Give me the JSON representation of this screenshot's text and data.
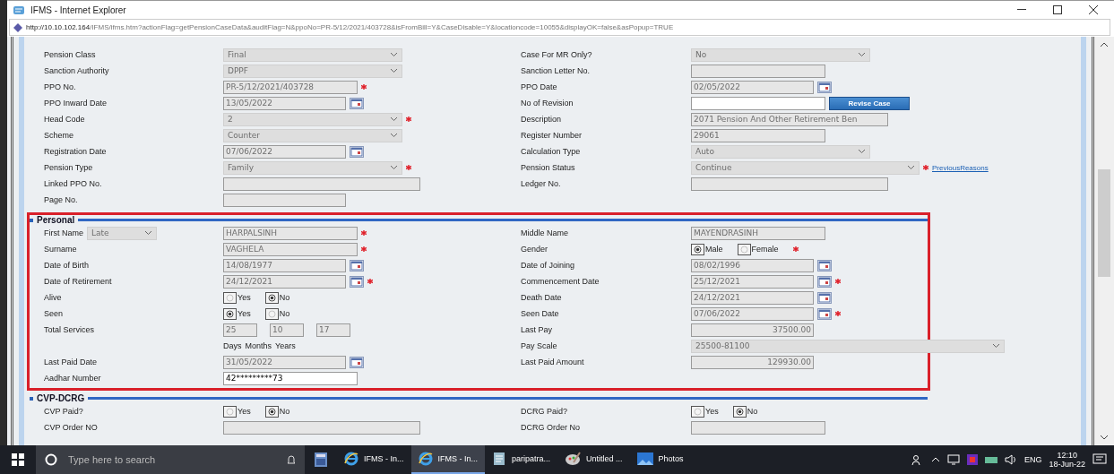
{
  "window": {
    "title": "IFMS - Internet Explorer"
  },
  "address": {
    "host": "http://10.10.102.164",
    "path": "/IFMS/ifms.htm?actionFlag=getPensionCaseData&auditFlag=N&ppoNo=PR-5/12/2021/403728&isFromBill=Y&CaseDisable=Y&locationcode=10055&displayOK=false&asPopup=TRUE"
  },
  "sections": [
    {
      "highlighted": false,
      "rows": [
        {
          "left": {
            "label": "Pension Class",
            "kind": "select",
            "value": "Final",
            "disabled": true
          },
          "right": {
            "label": "Case For MR Only?",
            "kind": "select",
            "value": "No",
            "disabled": true
          }
        },
        {
          "left": {
            "label": "Sanction Authority",
            "kind": "select",
            "value": "DPPF",
            "disabled": true
          },
          "right": {
            "label": "Sanction Letter No.",
            "kind": "text",
            "disabled": true
          }
        },
        {
          "left": {
            "label": "PPO No.",
            "kind": "text",
            "value": "PR-5/12/2021/403728",
            "disabled": true,
            "required": true
          },
          "right": {
            "label": "PPO Date",
            "kind": "date",
            "value": "02/05/2022",
            "disabled": true
          }
        },
        {
          "left": {
            "label": "PPO Inward Date",
            "kind": "date",
            "value": "13/05/2022",
            "disabled": true
          },
          "right": {
            "label": "No of Revision",
            "kind": "text_button",
            "disabled": false,
            "button": "Revise Case"
          }
        },
        {
          "left": {
            "label": "Head Code",
            "kind": "select",
            "value": "2",
            "disabled": true,
            "required": true
          },
          "right": {
            "label": "Description",
            "kind": "wide",
            "value": "2071 Pension And Other Retirement Ben",
            "disabled": true
          }
        },
        {
          "left": {
            "label": "Scheme",
            "kind": "select",
            "value": "Counter",
            "disabled": true
          },
          "right": {
            "label": "Register Number",
            "kind": "text",
            "value": "29061",
            "disabled": true
          }
        },
        {
          "left": {
            "label": "Registration Date",
            "kind": "date",
            "value": "07/06/2022",
            "disabled": true
          },
          "right": {
            "label": "Calculation Type",
            "kind": "select",
            "value": "Auto",
            "disabled": true
          }
        },
        {
          "left": {
            "label": "Pension Type",
            "kind": "select",
            "value": "Family",
            "disabled": true,
            "required": true
          },
          "right": {
            "label": "Pension Status",
            "kind": "longselect",
            "value": "Continue",
            "disabled": true,
            "required": true,
            "link": "PreviousReasons"
          }
        },
        {
          "left": {
            "label": "Linked PPO No.",
            "kind": "wide",
            "disabled": true
          },
          "right": {
            "label": "Ledger No.",
            "kind": "wide",
            "disabled": true
          }
        },
        {
          "left": {
            "label": "Page No.",
            "kind": "short",
            "disabled": true
          }
        }
      ]
    },
    {
      "title": "Personal",
      "highlighted": true,
      "rows": [
        {
          "left": {
            "label": "First Name",
            "kind": "name",
            "prefix": "Late",
            "value": "HARPALSINH",
            "disabled": true,
            "required": true
          },
          "right": {
            "label": "Middle Name",
            "kind": "text",
            "value": "MAYENDRASINH",
            "disabled": true
          }
        },
        {
          "left": {
            "label": "Surname",
            "kind": "text",
            "value": "VAGHELA",
            "disabled": true,
            "required": true
          },
          "right": {
            "label": "Gender",
            "kind": "radio",
            "required": true,
            "options": [
              {
                "label": "Male",
                "selected": true
              },
              {
                "label": "Female",
                "selected": false
              }
            ]
          }
        },
        {
          "left": {
            "label": "Date of Birth",
            "kind": "date",
            "value": "14/08/1977",
            "disabled": true
          },
          "right": {
            "label": "Date of Joining",
            "kind": "date",
            "value": "08/02/1996",
            "disabled": true
          }
        },
        {
          "left": {
            "label": "Date of Retirement",
            "kind": "date",
            "value": "24/12/2021",
            "disabled": true,
            "required": true
          },
          "right": {
            "label": "Commencement Date",
            "kind": "date",
            "value": "25/12/2021",
            "disabled": true,
            "required": true
          }
        },
        {
          "left": {
            "label": "Alive",
            "kind": "radio",
            "options": [
              {
                "label": "Yes",
                "selected": false
              },
              {
                "label": "No",
                "selected": true
              }
            ]
          },
          "right": {
            "label": "Death Date",
            "kind": "date",
            "value": "24/12/2021",
            "disabled": true
          }
        },
        {
          "left": {
            "label": "Seen",
            "kind": "radio",
            "options": [
              {
                "label": "Yes",
                "selected": true
              },
              {
                "label": "No",
                "selected": false
              }
            ]
          },
          "right": {
            "label": "Seen Date",
            "kind": "date",
            "value": "07/06/2022",
            "disabled": true,
            "required": true
          }
        },
        {
          "left": {
            "label": "Total Services",
            "kind": "services",
            "values": [
              "25",
              "10",
              "17"
            ],
            "disabled": true
          },
          "right": {
            "label": "Last Pay",
            "kind": "amount",
            "value": "37500.00",
            "disabled": true
          }
        },
        {
          "left": {
            "kind": "units",
            "units": [
              "Days",
              "Months",
              "Years"
            ]
          },
          "right": {
            "label": "Pay Scale",
            "kind": "longselect",
            "value": "25500-81100",
            "disabled": true
          }
        },
        {
          "left": {
            "label": "Last Paid Date",
            "kind": "date",
            "value": "31/05/2022",
            "disabled": true
          },
          "right": {
            "label": "Last Paid Amount",
            "kind": "amount",
            "value": "129930.00",
            "disabled": true
          }
        },
        {
          "left": {
            "label": "Aadhar Number",
            "kind": "text",
            "value": "42*********73",
            "disabled": false
          }
        }
      ]
    },
    {
      "title": "CVP-DCRG",
      "highlighted": false,
      "rows": [
        {
          "left": {
            "label": "CVP Paid?",
            "kind": "radio",
            "options": [
              {
                "label": "Yes",
                "selected": false
              },
              {
                "label": "No",
                "selected": true
              }
            ]
          },
          "right": {
            "label": "DCRG Paid?",
            "kind": "radio",
            "options": [
              {
                "label": "Yes",
                "selected": false
              },
              {
                "label": "No",
                "selected": true
              }
            ]
          }
        },
        {
          "left": {
            "label": "CVP Order NO",
            "kind": "wide",
            "disabled": true
          },
          "right": {
            "label": "DCRG Order No",
            "kind": "text",
            "disabled": true
          }
        }
      ]
    }
  ],
  "taskbar": {
    "search": {
      "placeholder": "Type here to search"
    },
    "apps": [
      {
        "label": "IFMS - In...",
        "kind": "ie",
        "selected": false
      },
      {
        "label": "IFMS - In...",
        "kind": "ie",
        "selected": true
      },
      {
        "label": "paripatra...",
        "kind": "doc",
        "selected": false
      },
      {
        "label": "Untitled ...",
        "kind": "paint",
        "selected": false
      },
      {
        "label": "Photos",
        "kind": "photos",
        "selected": false
      }
    ],
    "language": "ENG",
    "time": "12:10",
    "date": "18-Jun-22"
  }
}
